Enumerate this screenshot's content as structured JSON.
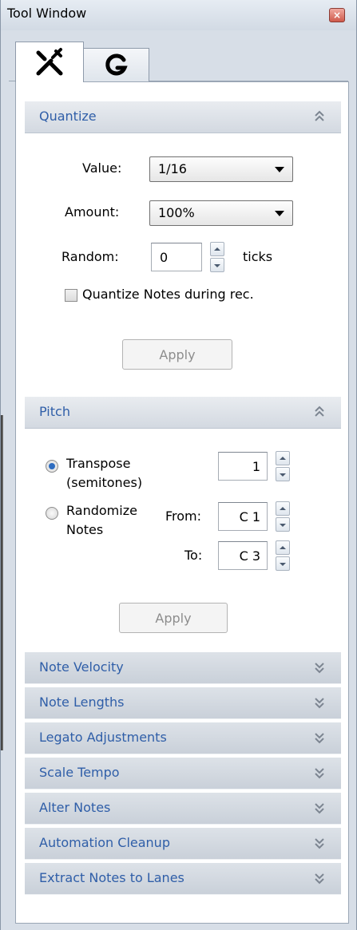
{
  "window": {
    "title": "Tool Window",
    "close_label": "×"
  },
  "tabs": [
    {
      "icon": "tools-icon",
      "active": true
    },
    {
      "icon": "g-script-icon",
      "active": false
    }
  ],
  "quantize": {
    "title": "Quantize",
    "value_label": "Value:",
    "value_selected": "1/16",
    "amount_label": "Amount:",
    "amount_selected": "100%",
    "random_label": "Random:",
    "random_value": "0",
    "random_unit": "ticks",
    "checkbox_label": "Quantize Notes during rec.",
    "checkbox_checked": false,
    "apply_label": "Apply"
  },
  "pitch": {
    "title": "Pitch",
    "transpose_label_line1": "Transpose",
    "transpose_label_line2": "(semitones)",
    "transpose_value": "1",
    "randomize_label_line1": "Randomize",
    "randomize_label_line2": "Notes",
    "from_label": "From:",
    "from_value": "C 1",
    "to_label": "To:",
    "to_value": "C 3",
    "apply_label": "Apply",
    "selected_mode": "transpose"
  },
  "sections": [
    "Note Velocity",
    "Note Lengths",
    "Legato Adjustments",
    "Scale Tempo",
    "Alter Notes",
    "Automation Cleanup",
    "Extract Notes to Lanes"
  ],
  "colors": {
    "section_title": "#2f5ea8",
    "accent": "#2d6cc0",
    "chevron": "#7c8591"
  }
}
